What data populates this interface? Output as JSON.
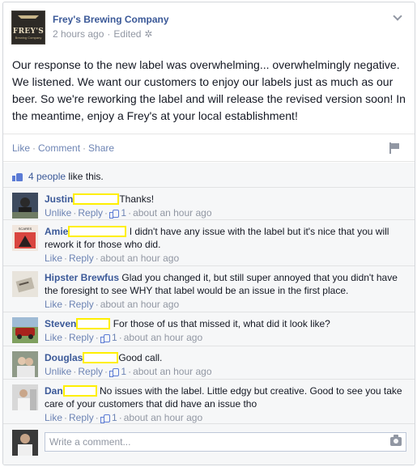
{
  "post": {
    "page_name": "Frey's Brewing Company",
    "logo_text": "FREY'S",
    "logo_subtext": "Brewing Company",
    "time": "2 hours ago",
    "edited": "Edited",
    "text": "Our response to the new label was overwhelming... overwhelmingly negative. We listened. We want our customers to enjoy our labels just as much as our beer. So we're reworking the label and will release the revised version soon! In the meantime, enjoy a Frey's at your local establishment!",
    "actions": {
      "like": "Like",
      "comment": "Comment",
      "share": "Share"
    }
  },
  "likes": {
    "count_label": "4 people",
    "suffix": "like this."
  },
  "comments": [
    {
      "author": "Justin",
      "text": "Thanks!",
      "actions": [
        "Unlike",
        "Reply"
      ],
      "likes": "1",
      "time": "about an hour ago",
      "avatar_color": "#4a5566"
    },
    {
      "author": "Amie",
      "text": "I didn't have any issue with the label but it's nice that you will rework it for those who did.",
      "actions": [
        "Like",
        "Reply"
      ],
      "likes": "",
      "time": "about an hour ago",
      "avatar_color": "#d9534f",
      "avatar_text": "SCARES THAT CARE"
    },
    {
      "author": "Hipster Brewfus",
      "text": "Glad you changed it, but still super annoyed that you didn't have the foresight to see WHY that label would be an issue in the first place.",
      "actions": [
        "Like",
        "Reply"
      ],
      "likes": "",
      "time": "about an hour ago",
      "avatar_color": "#c9c5bd"
    },
    {
      "author": "Steven",
      "text": "For those of us that missed it, what did it look like?",
      "actions": [
        "Like",
        "Reply"
      ],
      "likes": "1",
      "time": "about an hour ago",
      "avatar_color": "#8a2a24"
    },
    {
      "author": "Douglas",
      "text": "Good call.",
      "actions": [
        "Unlike",
        "Reply"
      ],
      "likes": "1",
      "time": "about an hour ago",
      "avatar_color": "#8a8f86"
    },
    {
      "author": "Dan",
      "text": "No issues with the label. Little edgy but creative. Good to see you take care of your customers that did have an issue tho",
      "actions": [
        "Like",
        "Reply"
      ],
      "likes": "1",
      "time": "about an hour ago",
      "avatar_color": "#cfcfcf"
    }
  ],
  "reply": {
    "placeholder": "Write a comment..."
  },
  "colors": {
    "link": "#3b5998",
    "meta": "#9197a3",
    "redaction": "#ffef00"
  }
}
